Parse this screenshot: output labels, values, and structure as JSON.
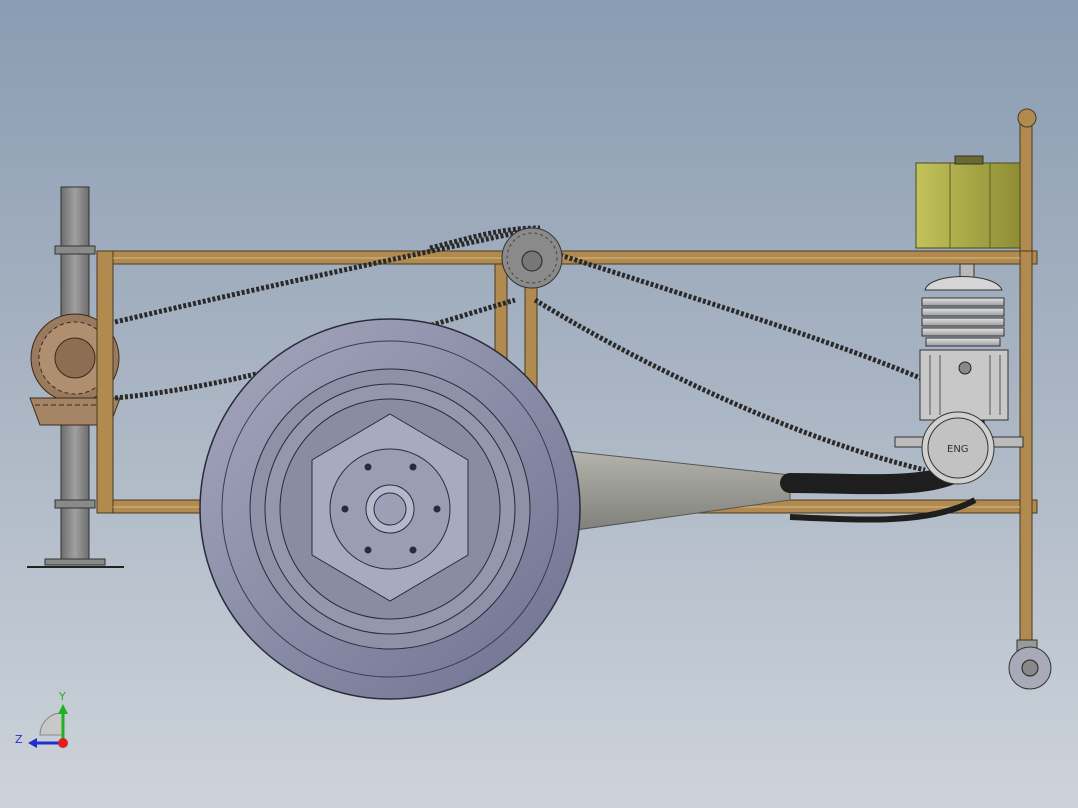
{
  "viewport": {
    "background_top": "#8a9cb2",
    "background_bottom": "#cdd3da"
  },
  "model": {
    "frame_color": "#b08a4e",
    "wheel_color": "#8c8fa6",
    "metal_color": "#8a8a8a",
    "tank_color": "#a9a84a",
    "engine_label": "ENG"
  },
  "triad": {
    "y_label": "Y",
    "z_label": "Z",
    "x_color": "#e02020",
    "y_color": "#20b020",
    "z_color": "#2030d0"
  }
}
